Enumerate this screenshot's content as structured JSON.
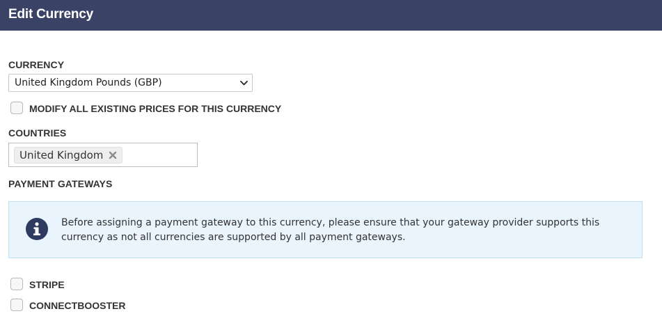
{
  "dialog": {
    "title": "Edit Currency"
  },
  "currency": {
    "label": "CURRENCY",
    "selected": "United Kingdom Pounds (GBP)"
  },
  "modify_prices": {
    "label": "MODIFY ALL EXISTING PRICES FOR THIS CURRENCY",
    "checked": false
  },
  "countries": {
    "label": "COUNTRIES",
    "tags": [
      "United Kingdom"
    ]
  },
  "payment_gateways": {
    "label": "PAYMENT GATEWAYS",
    "info_icon": "info-circle-icon",
    "notice": "Before assigning a payment gateway to this currency, please ensure that your gateway provider supports this currency as not all currencies are supported by all payment gateways.",
    "options": [
      {
        "label": "STRIPE",
        "checked": false
      },
      {
        "label": "CONNECTBOOSTER",
        "checked": false
      }
    ]
  },
  "colors": {
    "header_bg": "#3a4266",
    "info_bg": "#e9f4fd",
    "info_icon": "#2e3a5f"
  }
}
